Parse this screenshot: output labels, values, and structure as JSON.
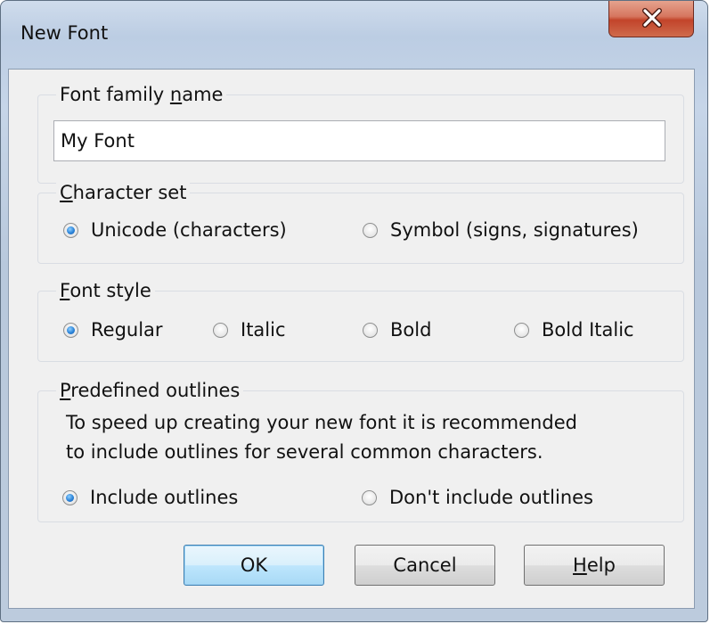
{
  "window": {
    "title": "New Font",
    "close_icon": "close-x-icon"
  },
  "font_family": {
    "label_pre": "Font family ",
    "label_hot": "n",
    "label_post": "ame",
    "value": "My Font"
  },
  "character_set": {
    "label_hot": "C",
    "label_post": "haracter set",
    "options": [
      {
        "label": "Unicode (characters)",
        "checked": true
      },
      {
        "label": "Symbol (signs, signatures)",
        "checked": false
      }
    ]
  },
  "font_style": {
    "label_hot": "F",
    "label_post": "ont style",
    "options": [
      {
        "label": "Regular",
        "checked": true
      },
      {
        "label": "Italic",
        "checked": false
      },
      {
        "label": "Bold",
        "checked": false
      },
      {
        "label": "Bold Italic",
        "checked": false
      }
    ]
  },
  "outlines": {
    "label_hot": "P",
    "label_post": "redefined outlines",
    "description_line1": "To speed up creating your new font it is recommended",
    "description_line2": "to include outlines for several common characters.",
    "options": [
      {
        "label": "Include outlines",
        "checked": true
      },
      {
        "label": "Don't include outlines",
        "checked": false
      }
    ]
  },
  "buttons": {
    "ok": "OK",
    "cancel": "Cancel",
    "help_hot": "H",
    "help_post": "elp"
  }
}
